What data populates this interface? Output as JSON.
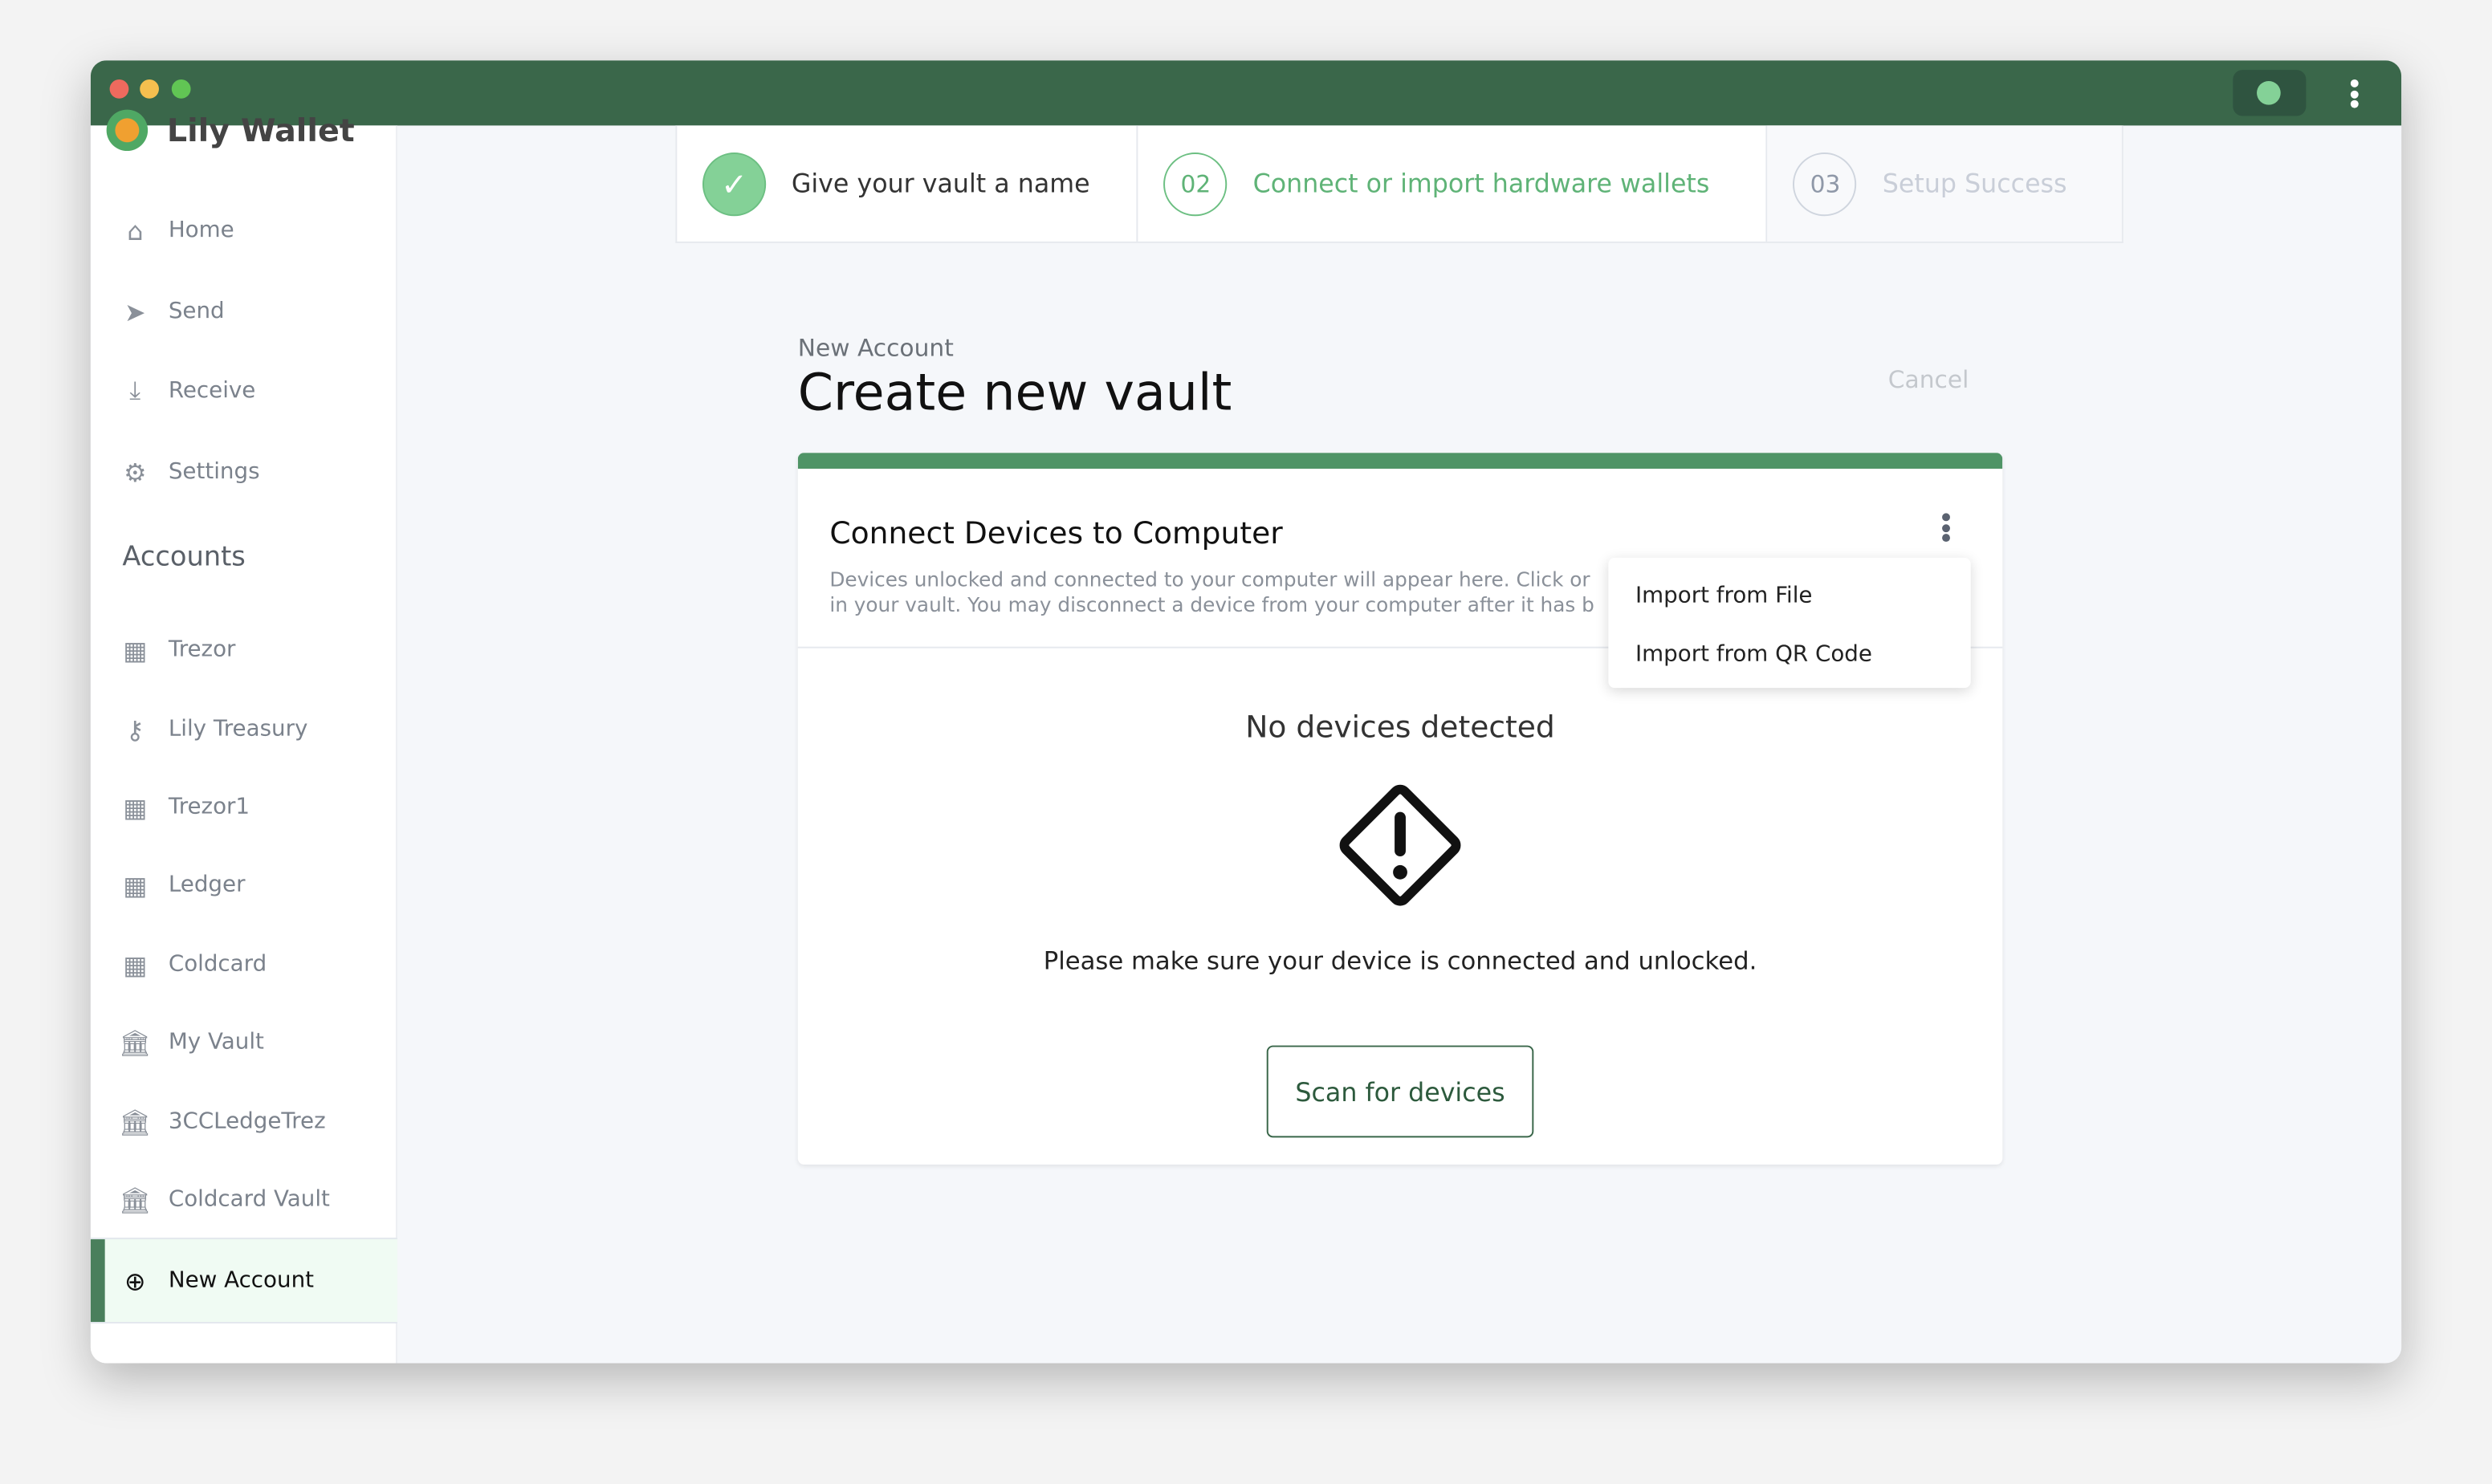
{
  "window": {
    "traffic_lights": [
      "#ee6a5e",
      "#f5bf4f",
      "#61c554"
    ],
    "titlebar_color": "#3a674a",
    "status_color": "#84d197"
  },
  "sidebar": {
    "logo_text": "Lily Wallet",
    "nav": [
      {
        "label": "Home",
        "icon": "home-icon"
      },
      {
        "label": "Send",
        "icon": "send-icon"
      },
      {
        "label": "Receive",
        "icon": "download-icon"
      },
      {
        "label": "Settings",
        "icon": "gear-icon"
      }
    ],
    "accounts_heading": "Accounts",
    "accounts": [
      {
        "label": "Trezor",
        "icon": "calculator-icon"
      },
      {
        "label": "Lily Treasury",
        "icon": "key-icon"
      },
      {
        "label": "Trezor1",
        "icon": "calculator-icon"
      },
      {
        "label": "Ledger",
        "icon": "calculator-icon"
      },
      {
        "label": "Coldcard",
        "icon": "calculator-icon"
      },
      {
        "label": "My Vault",
        "icon": "bank-icon"
      },
      {
        "label": "3CCLedgeTrez",
        "icon": "bank-icon"
      },
      {
        "label": "Coldcard Vault",
        "icon": "bank-icon"
      }
    ],
    "new_account": {
      "label": "New Account",
      "selected": true,
      "icon": "plus-circle-icon"
    }
  },
  "stepper": [
    {
      "number": "",
      "label": "Give your vault a name",
      "status": "complete"
    },
    {
      "number": "02",
      "label": "Connect or import hardware wallets",
      "status": "active"
    },
    {
      "number": "03",
      "label": "Setup Success",
      "status": "pending"
    }
  ],
  "header": {
    "subtitle": "New Account",
    "title": "Create new vault",
    "cancel": "Cancel"
  },
  "card": {
    "title": "Connect Devices to Computer",
    "desc_line1": "Devices unlocked and connected to your computer will appear here. Click or",
    "desc_line2": "in your vault. You may disconnect a device from your computer after it has b",
    "menu": [
      "Import from File",
      "Import from QR Code"
    ],
    "empty_title": "No devices detected",
    "empty_text": "Please make sure your device is connected and unlocked.",
    "scan_button": "Scan for devices"
  }
}
